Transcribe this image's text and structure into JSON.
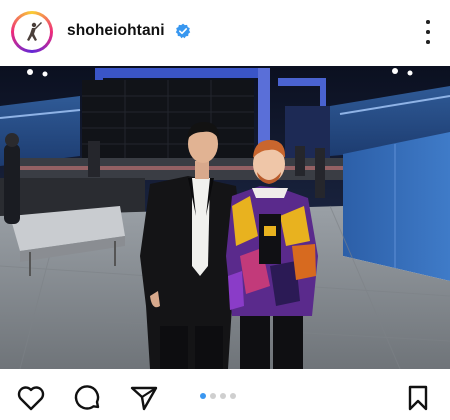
{
  "post": {
    "username": "shoheiohtani",
    "verified": true,
    "avatar_icon": "batter-silhouette-icon",
    "menu_icon": "more-vertical-icon"
  },
  "carousel": {
    "total": 4,
    "current": 1,
    "active_color": "#3a96f0"
  },
  "actions": {
    "like_icon": "heart-icon",
    "comment_icon": "comment-icon",
    "share_icon": "send-icon",
    "save_icon": "bookmark-icon"
  },
  "colors": {
    "verified_badge": "#3897f0",
    "stadium_blue": "#1b4fa8"
  }
}
